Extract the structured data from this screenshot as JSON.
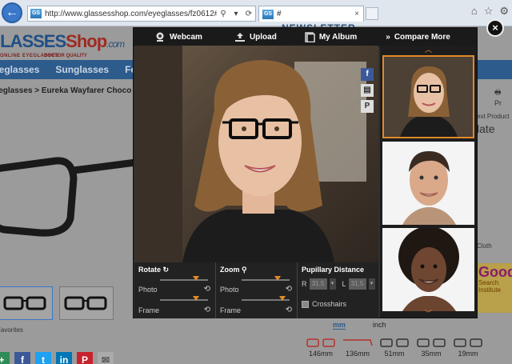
{
  "browser": {
    "url": "http://www.glassesshop.com/eyeglasses/fz0612#",
    "tab_title": "#",
    "favicon_text": "GS"
  },
  "site": {
    "logo_part1": "GLASSES",
    "logo_part2": "Shop",
    "logo_part3": ".com",
    "tagline": "ONLINE EYEGLASSES",
    "tagline2": "DOCTOR QUALITY",
    "newsletter": "NEWSLETTER",
    "nav": [
      "Eyeglasses",
      "Sunglasses",
      "Featured"
    ],
    "breadcrumb": "Eyeglasses > Eureka Wayfarer Choco",
    "favorites_label": "Favorites",
    "print_label": "Pr",
    "next_product_label": "ext Product",
    "product_title_fragment": "late",
    "cloth_label": "Cloth",
    "ad_title": "Good",
    "ad_subtitle": "Search Institute",
    "unit_mm": "mm",
    "unit_inch": "inch",
    "measurements": [
      "146mm",
      "136mm",
      "51mm",
      "35mm",
      "19mm"
    ]
  },
  "modal": {
    "toolbar": {
      "webcam": "Webcam",
      "upload": "Upload",
      "album": "My Album",
      "compare": "Compare More"
    },
    "rotate": {
      "title": "Rotate",
      "photo_label": "Photo",
      "frame_label": "Frame",
      "photo_value": 0.75,
      "frame_value": 0.75
    },
    "zoom": {
      "title": "Zoom",
      "photo_label": "Photo",
      "frame_label": "Frame",
      "photo_value": 0.75,
      "frame_value": 0.85
    },
    "pupillary": {
      "title": "Pupillary Distance",
      "r_label": "R",
      "r_value": "31.5",
      "l_label": "L",
      "l_value": "31.5",
      "crosshairs_label": "Crosshairs"
    }
  },
  "colors": {
    "accent": "#e08a2a",
    "nav_bg": "#2d5b8c",
    "modal_bg": "#303030"
  }
}
